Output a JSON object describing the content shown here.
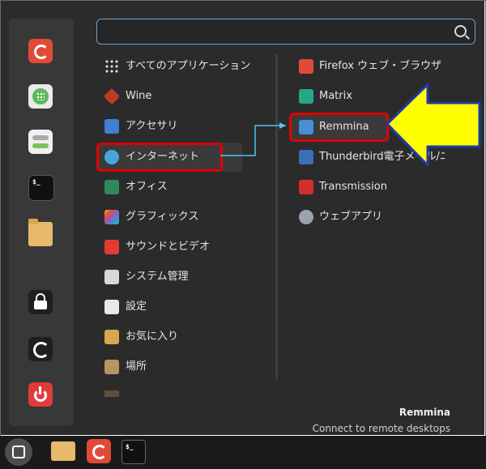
{
  "search": {
    "placeholder": ""
  },
  "categories": [
    {
      "label": "すべてのアプリケーション",
      "icon": "grid-icon"
    },
    {
      "label": "Wine",
      "icon": "wine-icon"
    },
    {
      "label": "アクセサリ",
      "icon": "accessories-icon"
    },
    {
      "label": "インターネット",
      "icon": "internet-cloud-icon"
    },
    {
      "label": "オフィス",
      "icon": "office-icon"
    },
    {
      "label": "グラフィックス",
      "icon": "graphics-icon"
    },
    {
      "label": "サウンドとビデオ",
      "icon": "sound-video-icon"
    },
    {
      "label": "システム管理",
      "icon": "system-admin-icon"
    },
    {
      "label": "設定",
      "icon": "settings-icon"
    },
    {
      "label": "お気に入り",
      "icon": "favorites-folder-icon"
    },
    {
      "label": "場所",
      "icon": "places-folder-icon"
    }
  ],
  "apps": [
    {
      "label": "Firefox ウェブ・ブラウザ",
      "icon": "firefox-icon"
    },
    {
      "label": "Matrix",
      "icon": "matrix-icon"
    },
    {
      "label": "Remmina",
      "icon": "remmina-icon"
    },
    {
      "label": "Thunderbird電子メール/ニュース",
      "icon": "thunderbird-icon"
    },
    {
      "label": "Transmission",
      "icon": "transmission-icon"
    },
    {
      "label": "ウェブアプリ",
      "icon": "webapp-icon"
    }
  ],
  "description": {
    "title": "Remmina",
    "subtitle": "Connect to remote desktops"
  },
  "colors": {
    "accent": "#6fa3c9",
    "highlight": "#e00000",
    "arrow": "#ffff00"
  }
}
